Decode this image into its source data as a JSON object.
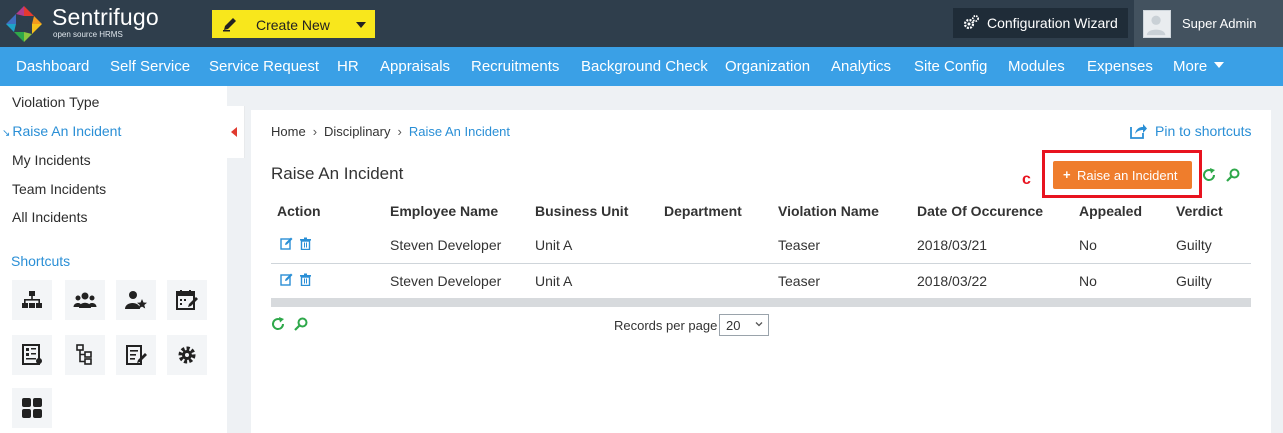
{
  "app": {
    "brand_name": "Sentrifugo",
    "brand_tagline": "open source HRMS",
    "create_new_label": "Create New",
    "config_wizard_label": "Configuration Wizard",
    "user_name": "Super Admin"
  },
  "nav": {
    "items": [
      {
        "label": "Dashboard"
      },
      {
        "label": "Self Service"
      },
      {
        "label": "Service Request"
      },
      {
        "label": "HR"
      },
      {
        "label": "Appraisals"
      },
      {
        "label": "Recruitments"
      },
      {
        "label": "Background Check"
      },
      {
        "label": "Organization"
      },
      {
        "label": "Analytics"
      },
      {
        "label": "Site Config"
      },
      {
        "label": "Modules"
      },
      {
        "label": "Expenses"
      },
      {
        "label": "More"
      }
    ]
  },
  "sidebar": {
    "items": [
      {
        "label": "Violation Type"
      },
      {
        "label": "Raise An Incident"
      },
      {
        "label": "My Incidents"
      },
      {
        "label": "Team Incidents"
      },
      {
        "label": "All Incidents"
      }
    ],
    "active_index": 1,
    "shortcuts_title": "Shortcuts"
  },
  "breadcrumb": {
    "items": [
      {
        "label": "Home"
      },
      {
        "label": "Disciplinary"
      },
      {
        "label": "Raise An Incident"
      }
    ]
  },
  "pin_label": "Pin to shortcuts",
  "page_title": "Raise An Incident",
  "raise_button_label": "Raise an Incident",
  "annotation_mark": "c",
  "table": {
    "headers": [
      "Action",
      "Employee Name",
      "Business Unit",
      "Department",
      "Violation Name",
      "Date Of Occurence",
      "Appealed",
      "Verdict"
    ],
    "rows": [
      [
        "Steven Developer",
        "Unit A",
        "",
        "Teaser",
        "2018/03/21",
        "No",
        "Guilty"
      ],
      [
        "Steven Developer",
        "Unit A",
        "",
        "Teaser",
        "2018/03/22",
        "No",
        "Guilty"
      ]
    ]
  },
  "pagination": {
    "records_per_page_label": "Records per page",
    "records_per_page_value": "20"
  },
  "colors": {
    "topbar": "#2f3e4c",
    "navbar": "#3aa0e6",
    "create_button": "#f8e71c",
    "raise_button": "#ef7d2c",
    "highlight": "#e8131f",
    "link": "#2a8fd6"
  }
}
